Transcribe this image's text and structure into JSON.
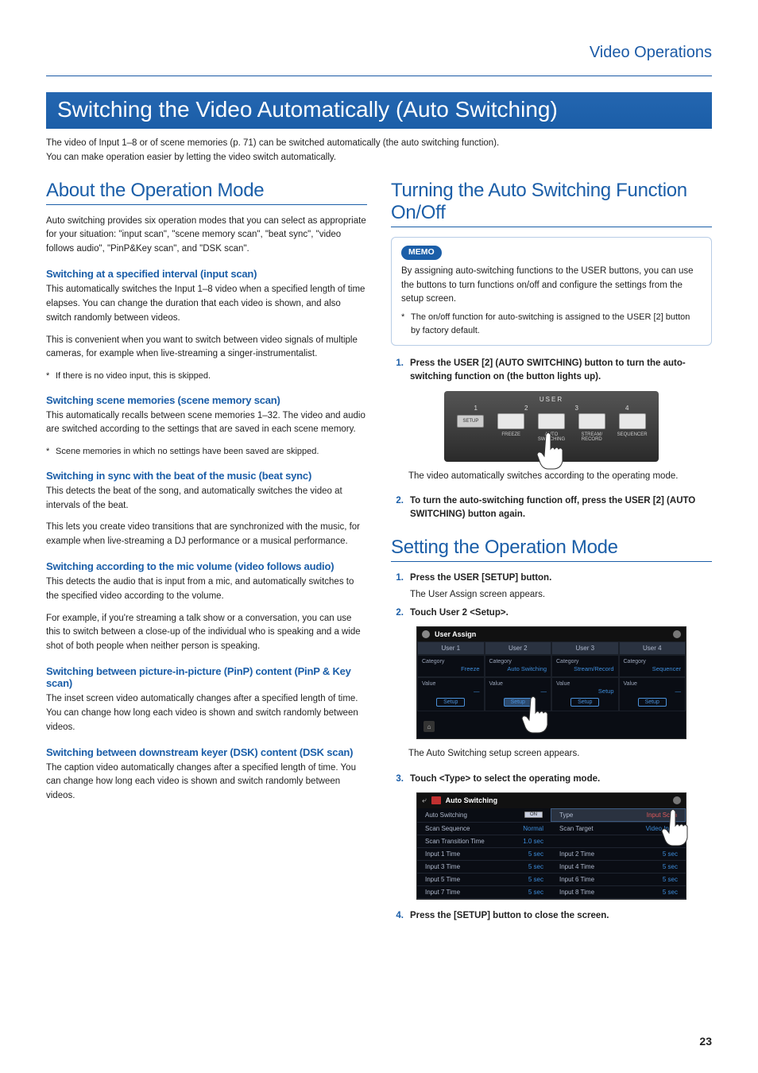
{
  "header": {
    "section": "Video Operations"
  },
  "title": "Switching the Video Automatically (Auto Switching)",
  "intro": [
    "The video of Input 1–8 or of scene memories (p. 71) can be switched automatically (the auto switching function).",
    "You can make operation easier by letting the video switch automatically."
  ],
  "left": {
    "h2": "About the Operation Mode",
    "p1": "Auto switching provides six operation modes that you can select as appropriate for your situation: \"input scan\", \"scene memory scan\", \"beat sync\", \"video follows audio\", \"PinP&Key scan\", and \"DSK scan\".",
    "s1": {
      "h": "Switching at a specified interval (input scan)",
      "p1": "This automatically switches the Input 1–8 video when a specified length of time elapses. You can change the duration that each video is shown, and also switch randomly between videos.",
      "p2": "This is convenient when you want to switch between video signals of multiple cameras, for example when live-streaming a singer-instrumentalist.",
      "note": "If there is no video input, this is skipped."
    },
    "s2": {
      "h": "Switching scene memories (scene memory scan)",
      "p1": "This automatically recalls between scene memories 1–32. The video and audio are switched according to the settings that are saved in each scene memory.",
      "note": "Scene memories in which no settings have been saved are skipped."
    },
    "s3": {
      "h": "Switching in sync with the beat of the music (beat sync)",
      "p1": "This detects the beat of the song, and automatically switches the video at intervals of the beat.",
      "p2": "This lets you create video transitions that are synchronized with the music, for example when live-streaming a DJ performance or a musical performance."
    },
    "s4": {
      "h": "Switching according to the mic volume (video follows audio)",
      "p1": "This detects the audio that is input from a mic, and automatically switches to the specified video according to the volume.",
      "p2": "For example, if you're streaming a talk show or a conversation, you can use this to switch between a close-up of the individual who is speaking and a wide shot of both people when neither person is speaking."
    },
    "s5": {
      "h": "Switching between picture-in-picture (PinP) content (PinP & Key scan)",
      "p1": "The inset screen video automatically changes after a specified length of time. You can change how long each video is shown and switch randomly between videos."
    },
    "s6": {
      "h": "Switching between downstream keyer (DSK) content (DSK scan)",
      "p1": "The caption video automatically changes after a specified length of time. You can change how long each video is shown and switch randomly between videos."
    }
  },
  "right": {
    "h2a": "Turning the Auto Switching Function On/Off",
    "memo": {
      "label": "MEMO",
      "p": "By assigning auto-switching functions to the USER buttons, you can use the buttons to turn functions on/off and configure the settings from the setup screen.",
      "note": "The on/off function for auto-switching is assigned to the USER [2] button by factory default."
    },
    "step1": {
      "n": "1.",
      "t": "Press the USER [2] (AUTO SWITCHING) button to turn the auto-switching function on (the button lights up)."
    },
    "cap1": "The video automatically switches according to the operating mode.",
    "step2": {
      "n": "2.",
      "t": "To turn the auto-switching function off, press the USER [2] (AUTO SWITCHING) button again."
    },
    "h2b": "Setting the Operation Mode",
    "stepB1": {
      "n": "1.",
      "t": "Press the USER [SETUP] button.",
      "sub": "The User Assign screen appears."
    },
    "stepB2": {
      "n": "2.",
      "t": "Touch User 2 <Setup>."
    },
    "capB2": "The Auto Switching setup screen appears.",
    "stepB3": {
      "n": "3.",
      "t": "Touch <Type> to select the operating mode."
    },
    "stepB4": {
      "n": "4.",
      "t": "Press the [SETUP] button to close the screen."
    },
    "ui1": {
      "user": "USER",
      "nums": [
        "1",
        "2",
        "3",
        "4"
      ],
      "setup": "SETUP",
      "labels": [
        "FREEZE",
        "AUTO\nSWITCHING",
        "STREAM/\nRECORD",
        "SEQUENCER"
      ]
    },
    "ui2": {
      "title": "User Assign",
      "tabs": [
        "User 1",
        "User 2",
        "User 3",
        "User 4"
      ],
      "catLabel": "Category",
      "valLabel": "Value",
      "cats": [
        "Freeze",
        "Auto Switching",
        "Stream/Record",
        "Sequencer"
      ],
      "vals": [
        "—",
        "—",
        "Setup",
        "—"
      ],
      "setup": "Setup"
    },
    "ui3": {
      "title": "Auto Switching",
      "rows": [
        {
          "l": "Auto Switching",
          "v": "ON",
          "type": "btn",
          "l2": "Type",
          "v2": "Input Scan",
          "hl": true
        },
        {
          "l": "Scan Sequence",
          "v": "Normal",
          "l2": "Scan Target",
          "v2": "Video Input"
        },
        {
          "l": "Scan Transition Time",
          "v": "1.0 sec",
          "l2": "",
          "v2": ""
        },
        {
          "l": "Input 1 Time",
          "v": "5 sec",
          "l2": "Input 2 Time",
          "v2": "5 sec"
        },
        {
          "l": "Input 3 Time",
          "v": "5 sec",
          "l2": "Input 4 Time",
          "v2": "5 sec"
        },
        {
          "l": "Input 5 Time",
          "v": "5 sec",
          "l2": "Input 6 Time",
          "v2": "5 sec"
        },
        {
          "l": "Input 7 Time",
          "v": "5 sec",
          "l2": "Input 8 Time",
          "v2": "5 sec"
        }
      ]
    }
  },
  "page_num": "23"
}
